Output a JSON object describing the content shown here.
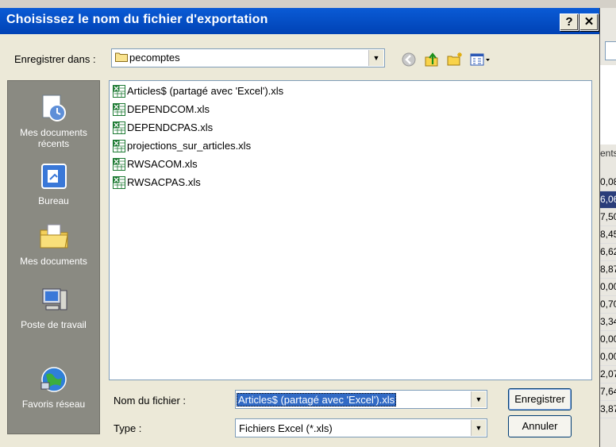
{
  "dialog": {
    "title": "Choisissez le nom du fichier d'exportation",
    "help_button": "?",
    "close_button": "✕"
  },
  "save_in": {
    "label": "Enregistrer dans :",
    "folder": "pecomptes"
  },
  "places": [
    {
      "label": "Mes documents récents",
      "icon": "recent-documents-icon"
    },
    {
      "label": "Bureau",
      "icon": "desktop-icon"
    },
    {
      "label": "Mes documents",
      "icon": "my-documents-icon"
    },
    {
      "label": "Poste de travail",
      "icon": "my-computer-icon"
    },
    {
      "label": "Favoris réseau",
      "icon": "network-places-icon"
    }
  ],
  "files": [
    "Articles$ (partagé avec 'Excel').xls",
    "DEPENDCOM.xls",
    "DEPENDCPAS.xls",
    "projections_sur_articles.xls",
    "RWSACOM.xls",
    "RWSACPAS.xls"
  ],
  "filename": {
    "label": "Nom du fichier :",
    "value": "Articles$ (partagé avec 'Excel').xls"
  },
  "filetype": {
    "label": "Type :",
    "value": "Fichiers Excel (*.xls)"
  },
  "buttons": {
    "save": "Enregistrer",
    "cancel": "Annuler"
  },
  "background_window": {
    "partial_label": "ents",
    "partial_values": [
      "0,08",
      "6,06",
      "7,50",
      "8,45",
      "6,62",
      "8,87",
      "0,00",
      "0,70",
      "3,34",
      "0,00",
      "0,00",
      "2,07",
      "7,64",
      "3,87"
    ]
  },
  "colors": {
    "titlebar": "#0a5bd6",
    "places_bar": "#8a8a82",
    "selection": "#316ac5"
  }
}
